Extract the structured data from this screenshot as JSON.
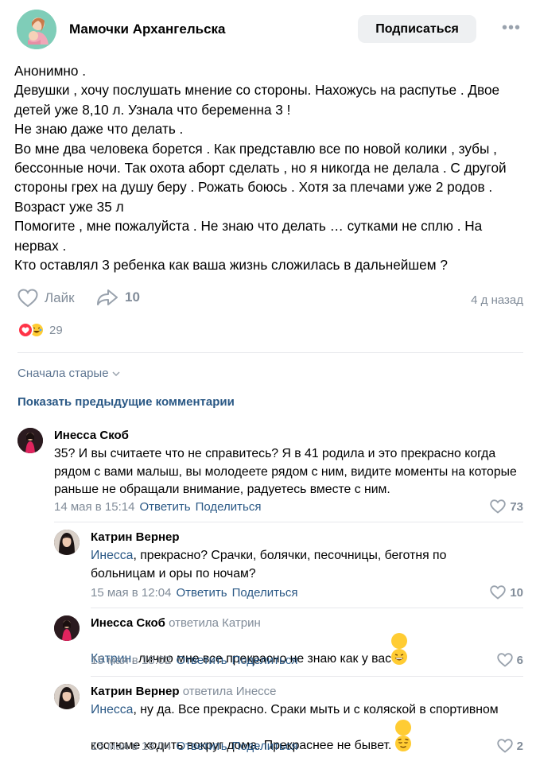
{
  "header": {
    "group_name": "Мамочки Архангельска",
    "subscribe_label": "Подписаться",
    "more_label": "•••"
  },
  "post": {
    "text": "Анонимно .\nДевушки , хочу послушать мнение со стороны. Нахожусь на распутье . Двое детей уже 8,10 л. Узнала что беременна 3 !\nНе знаю даже что делать .\nВо мне два человека борется . Как представлю все по новой колики , зубы , бессонные ночи. Так охота аборт сделать , но я никогда не делала . С другой стороны грех на душу беру . Рожать боюсь . Хотя за плечами уже 2 родов . Возраст уже 35 л\nПомогите , мне пожалуйста . Не знаю что делать … сутками не сплю . На нервах .\nКто оставлял 3 ребенка как ваша жизнь сложилась в дальнейшем ?",
    "like_label": "Лайк",
    "share_count": "10",
    "time": "4 д назад",
    "reactions_count": "29"
  },
  "comments_section": {
    "sort_label": "Сначала старые",
    "show_previous_label": "Показать предыдущие комментарии"
  },
  "comments": [
    {
      "author": "Инесса Скоб",
      "replied_to": "",
      "mention": "",
      "text": "35? И вы считаете что не справитесь? Я в 41 родила и это прекрасно когда рядом с вами малыш, вы молодеете рядом с ним, видите моменты на которые раньше не обращали внимание, радуетесь вместе с ним.",
      "date": "14 мая в 15:14",
      "reply_label": "Ответить",
      "share_label": "Поделиться",
      "likes": "73"
    },
    {
      "author": "Катрин Вернер",
      "replied_to": "",
      "mention": "Инесса",
      "text": ", прекрасно? Срачки, болячки, песочницы, беготня по больницам и оры по ночам?",
      "date": "15 мая в 12:04",
      "reply_label": "Ответить",
      "share_label": "Поделиться",
      "likes": "10"
    },
    {
      "author": "Инесса Скоб",
      "replied_to": "ответила Катрин",
      "mention": "Катрин",
      "text": ", лично мне все прекрасно не знаю как у вас",
      "date": "15 мая в 18:02",
      "reply_label": "Ответить",
      "share_label": "Поделиться",
      "likes": "6"
    },
    {
      "author": "Катрин Вернер",
      "replied_to": "ответила Инессе",
      "mention": "Инесса",
      "text": ", ну да. Все прекрасно. Сраки мыть и с коляской в спортивном костюме ходить вокруг дома. Прекраснее не бывет.",
      "date": "15 мая в 18:04",
      "reply_label": "Ответить",
      "share_label": "Поделиться",
      "likes": "2"
    }
  ],
  "icons": {
    "like": "heart-outline-icon",
    "share": "share-arrow-icon",
    "more": "more-dots-icon",
    "sort": "chevron-down-icon",
    "comment_like": "heart-outline-icon"
  },
  "colors": {
    "link": "#2a5885",
    "secondary": "#818c99",
    "button_bg": "#eef0f2",
    "divider": "#e7e8ec"
  }
}
